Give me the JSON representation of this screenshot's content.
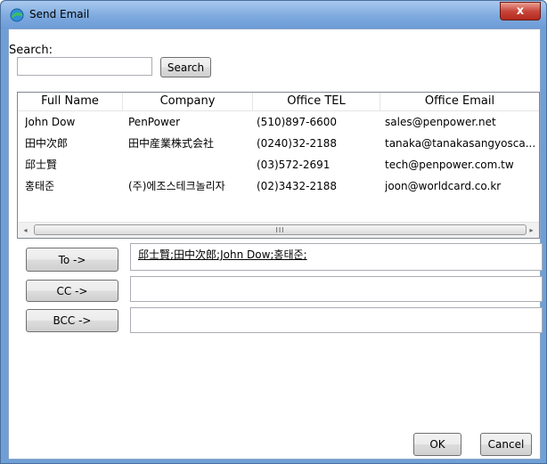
{
  "window": {
    "title": "Send Email",
    "close_glyph": "x"
  },
  "search": {
    "label": "Search:",
    "value": "",
    "button": "Search"
  },
  "table": {
    "headers": [
      "Full Name",
      "Company",
      "Office TEL",
      "Office Email"
    ],
    "rows": [
      [
        "John Dow",
        "PenPower",
        "(510)897-6600",
        "sales@penpower.net"
      ],
      [
        "田中次郎",
        "田中産業株式会社",
        "(0240)32-2188",
        "tanaka@tanakasangyosca..."
      ],
      [
        "邱士賢",
        "",
        "(03)572-2691",
        "tech@penpower.com.tw"
      ],
      [
        "홍태준",
        "(주)에조스테크놀리자",
        "(02)3432-2188",
        "joon@worldcard.co.kr"
      ]
    ],
    "scroll_left": "◂",
    "scroll_right": "▸",
    "scroll_grip": "III"
  },
  "recipients": {
    "to_label": "To ->",
    "to_value": "邱士賢;田中次郎;John Dow;홍태준;",
    "cc_label": "CC ->",
    "cc_value": "",
    "bcc_label": "BCC ->",
    "bcc_value": ""
  },
  "footer": {
    "ok": "OK",
    "cancel": "Cancel"
  },
  "icons": {
    "app": "send-email-app-icon",
    "close": "close-icon"
  }
}
